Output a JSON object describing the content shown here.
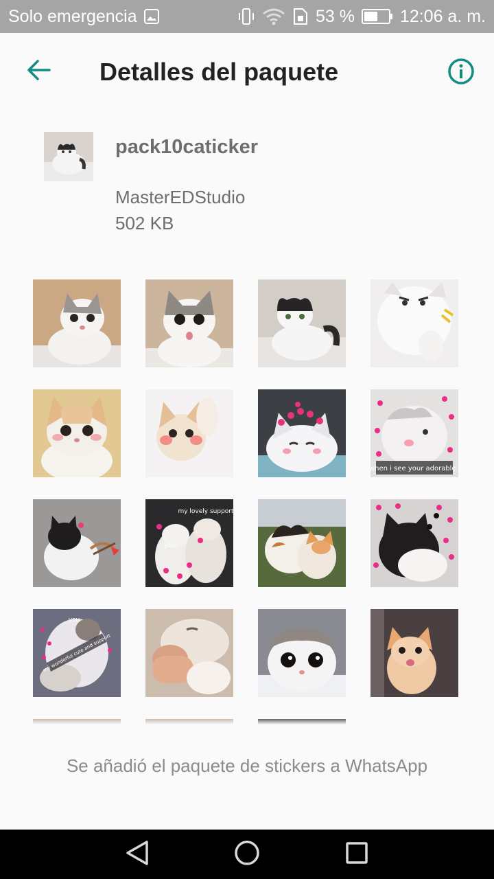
{
  "status_bar": {
    "carrier": "Solo emergencia",
    "battery": "53 %",
    "time": "12:06 a. m.",
    "icons": [
      "gallery-icon",
      "vibrate-icon",
      "wifi-icon",
      "sim-icon",
      "battery-icon"
    ]
  },
  "app_bar": {
    "title": "Detalles del paquete",
    "back_icon": "arrow-left-icon",
    "info_icon": "info-icon",
    "accent": "#128c7e"
  },
  "pack": {
    "name": "pack10caticker",
    "author": "MasterEDStudio",
    "size": "502 KB"
  },
  "stickers": [
    {
      "name": "cat-sticker-1"
    },
    {
      "name": "cat-sticker-2"
    },
    {
      "name": "cat-sticker-3"
    },
    {
      "name": "cat-sticker-4"
    },
    {
      "name": "cat-sticker-5"
    },
    {
      "name": "cat-sticker-6"
    },
    {
      "name": "cat-sticker-7"
    },
    {
      "name": "cat-sticker-8",
      "caption": "me when i see your adorable face"
    },
    {
      "name": "cat-sticker-9"
    },
    {
      "name": "cat-sticker-10",
      "caption_top": "my lovely support",
      "caption_bottom": "you"
    },
    {
      "name": "cat-sticker-11"
    },
    {
      "name": "cat-sticker-12"
    },
    {
      "name": "cat-sticker-13",
      "caption_top": "you",
      "caption_bottom": "my wonderful cute and support"
    },
    {
      "name": "cat-sticker-14"
    },
    {
      "name": "cat-sticker-15"
    },
    {
      "name": "cat-sticker-16"
    }
  ],
  "footer": {
    "message": "Se añadió el paquete de stickers a WhatsApp"
  },
  "nav_bar": {
    "icons": [
      "back-triangle-icon",
      "home-circle-icon",
      "recents-square-icon"
    ]
  }
}
